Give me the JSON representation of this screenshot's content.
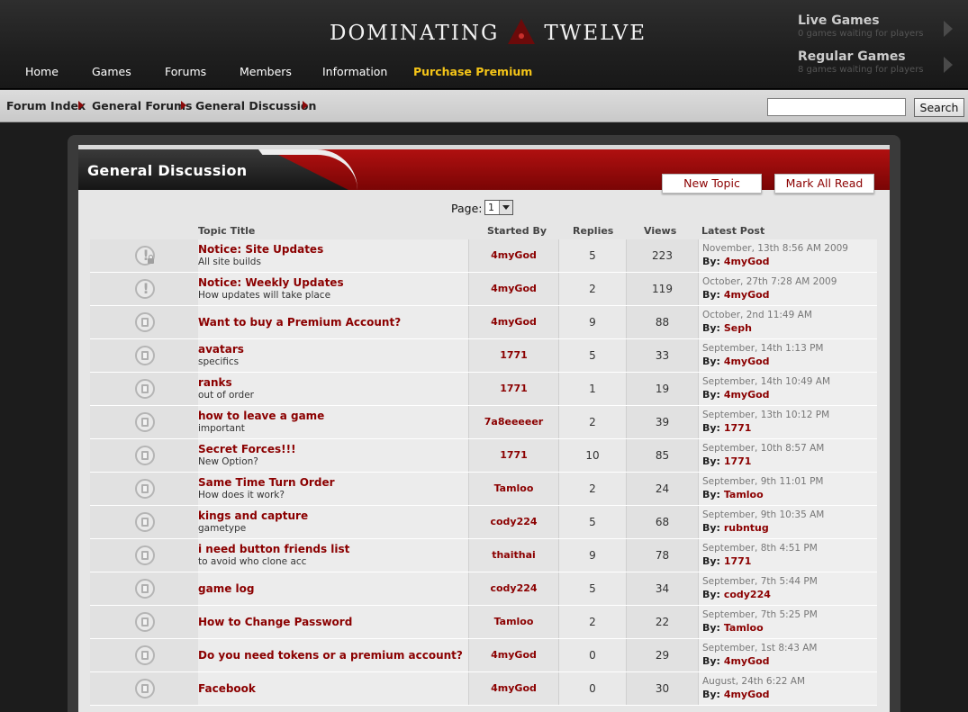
{
  "site": {
    "logo_left": "DOMINATING",
    "logo_right": "TWELVE"
  },
  "nav": [
    {
      "label": "Home"
    },
    {
      "label": "Games"
    },
    {
      "label": "Forums"
    },
    {
      "label": "Members"
    },
    {
      "label": "Information"
    },
    {
      "label": "Purchase Premium"
    }
  ],
  "games_status": {
    "live": {
      "title": "Live Games",
      "subtitle": "0 games waiting for players"
    },
    "regular": {
      "title": "Regular Games",
      "subtitle": "8 games waiting for players"
    }
  },
  "breadcrumb": [
    {
      "label": "Forum Index"
    },
    {
      "label": "General Forums"
    },
    {
      "label": "General Discussion"
    }
  ],
  "search": {
    "value": "",
    "button_label": "Search"
  },
  "forum": {
    "title": "General Discussion",
    "new_topic_label": "New Topic",
    "mark_all_read_label": "Mark All Read",
    "page_label": "Page:",
    "page_value": "1",
    "columns": {
      "title": "Topic Title",
      "started_by": "Started By",
      "replies": "Replies",
      "views": "Views",
      "latest_post": "Latest Post"
    },
    "by_prefix": "By:",
    "topics": [
      {
        "icon": "locked-announcement-icon",
        "title": "Notice: Site Updates",
        "subtitle": "All site builds",
        "started_by": "4myGod",
        "replies": "5",
        "views": "223",
        "latest_date": "November, 13th 8:56 AM 2009",
        "latest_by": "4myGod"
      },
      {
        "icon": "announcement-icon",
        "title": "Notice: Weekly Updates",
        "subtitle": "How updates will take place",
        "started_by": "4myGod",
        "replies": "2",
        "views": "119",
        "latest_date": "October, 27th 7:28 AM 2009",
        "latest_by": "4myGod"
      },
      {
        "icon": "topic-icon",
        "title": "Want to buy a Premium Account?",
        "subtitle": "",
        "started_by": "4myGod",
        "replies": "9",
        "views": "88",
        "latest_date": "October, 2nd 11:49 AM",
        "latest_by": "Seph"
      },
      {
        "icon": "topic-icon",
        "title": "avatars",
        "subtitle": "specifics",
        "started_by": "1771",
        "replies": "5",
        "views": "33",
        "latest_date": "September, 14th 1:13 PM",
        "latest_by": "4myGod"
      },
      {
        "icon": "topic-icon",
        "title": "ranks",
        "subtitle": "out of order",
        "started_by": "1771",
        "replies": "1",
        "views": "19",
        "latest_date": "September, 14th 10:49 AM",
        "latest_by": "4myGod"
      },
      {
        "icon": "topic-icon",
        "title": "how to leave a game",
        "subtitle": "important",
        "started_by": "7a8eeeeer",
        "replies": "2",
        "views": "39",
        "latest_date": "September, 13th 10:12 PM",
        "latest_by": "1771"
      },
      {
        "icon": "topic-icon",
        "title": "Secret Forces!!!",
        "subtitle": "New Option?",
        "started_by": "1771",
        "replies": "10",
        "views": "85",
        "latest_date": "September, 10th 8:57 AM",
        "latest_by": "1771"
      },
      {
        "icon": "topic-icon",
        "title": "Same Time Turn Order",
        "subtitle": "How does it work?",
        "started_by": "Tamloo",
        "replies": "2",
        "views": "24",
        "latest_date": "September, 9th 11:01 PM",
        "latest_by": "Tamloo"
      },
      {
        "icon": "topic-icon",
        "title": "kings and capture",
        "subtitle": "gametype",
        "started_by": "cody224",
        "replies": "5",
        "views": "68",
        "latest_date": "September, 9th 10:35 AM",
        "latest_by": "rubntug"
      },
      {
        "icon": "topic-icon",
        "title": "i need button friends list",
        "subtitle": "to avoid who clone acc",
        "started_by": "thaithai",
        "replies": "9",
        "views": "78",
        "latest_date": "September, 8th 4:51 PM",
        "latest_by": "1771"
      },
      {
        "icon": "topic-icon",
        "title": "game log",
        "subtitle": "",
        "started_by": "cody224",
        "replies": "5",
        "views": "34",
        "latest_date": "September, 7th 5:44 PM",
        "latest_by": "cody224"
      },
      {
        "icon": "topic-icon",
        "title": "How to Change Password",
        "subtitle": "",
        "started_by": "Tamloo",
        "replies": "2",
        "views": "22",
        "latest_date": "September, 7th 5:25 PM",
        "latest_by": "Tamloo"
      },
      {
        "icon": "topic-icon",
        "title": "Do you need tokens or a premium account?",
        "subtitle": "",
        "started_by": "4myGod",
        "replies": "0",
        "views": "29",
        "latest_date": "September, 1st 8:43 AM",
        "latest_by": "4myGod"
      },
      {
        "icon": "topic-icon",
        "title": "Facebook",
        "subtitle": "",
        "started_by": "4myGod",
        "replies": "0",
        "views": "30",
        "latest_date": "August, 24th 6:22 AM",
        "latest_by": "4myGod"
      }
    ]
  },
  "colors": {
    "accent_red": "#8b0000",
    "premium_yellow": "#f5c518"
  }
}
